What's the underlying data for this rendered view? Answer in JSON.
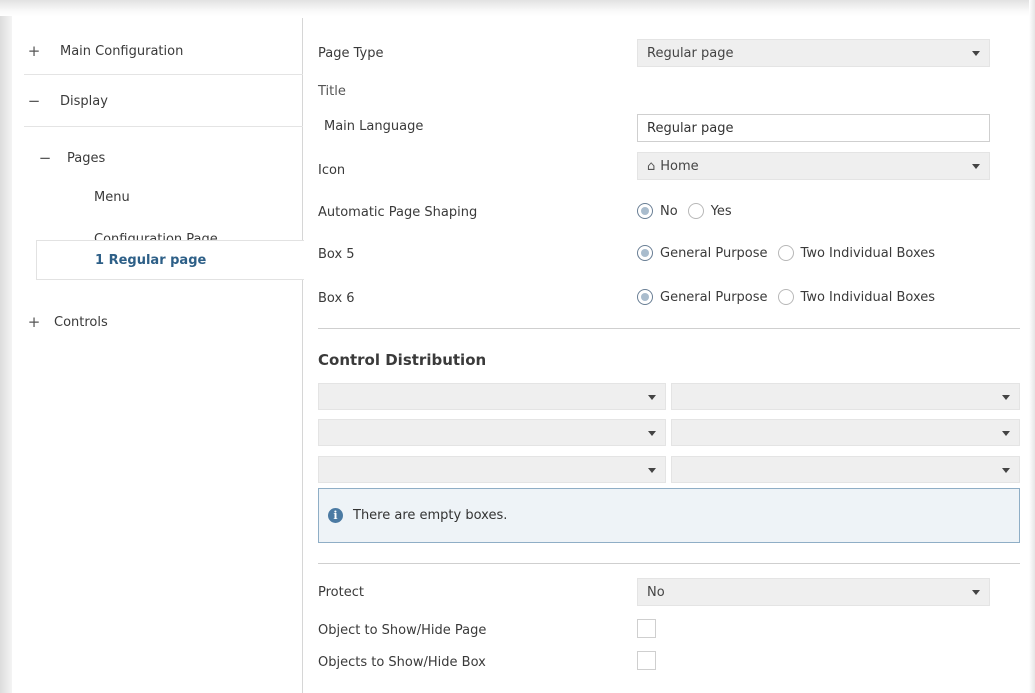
{
  "sidebar": {
    "main_configuration": {
      "expander": "+",
      "label": "Main Configuration"
    },
    "display": {
      "expander": "−",
      "label": "Display"
    },
    "pages": {
      "expander": "−",
      "label": "Pages"
    },
    "menu": {
      "label": "Menu"
    },
    "configuration_page": {
      "label": "Configuration Page"
    },
    "regular_page": {
      "label": "1 Regular page"
    },
    "controls": {
      "expander": "+",
      "label": "Controls"
    }
  },
  "main": {
    "page_type": {
      "label": "Page Type",
      "value": "Regular page"
    },
    "title": {
      "label": "Title"
    },
    "main_language": {
      "label": "Main Language",
      "value": "Regular page"
    },
    "icon": {
      "label": "Icon",
      "value": "Home",
      "icon_name": "home-icon",
      "glyph": "⌂"
    },
    "automatic_page_shaping": {
      "label": "Automatic Page Shaping",
      "options": [
        "No",
        "Yes"
      ],
      "selected": "No"
    },
    "box5": {
      "label": "Box 5",
      "options": [
        "General Purpose",
        "Two Individual Boxes"
      ],
      "selected": "General Purpose"
    },
    "box6": {
      "label": "Box 6",
      "options": [
        "General Purpose",
        "Two Individual Boxes"
      ],
      "selected": "General Purpose"
    },
    "control_distribution": {
      "title": "Control Distribution"
    },
    "info": {
      "glyph": "i",
      "message": "There are empty boxes."
    },
    "protect": {
      "label": "Protect",
      "value": "No"
    },
    "object_show_hide_page": {
      "label": "Object to Show/Hide Page",
      "checked": false
    },
    "objects_show_hide_box": {
      "label": "Objects to Show/Hide Box",
      "checked": false
    }
  },
  "colors": {
    "accent": "#2d5f87",
    "info_border": "#8faec6",
    "info_bg": "#eef3f7",
    "radio_fill": "#a9bccd"
  }
}
